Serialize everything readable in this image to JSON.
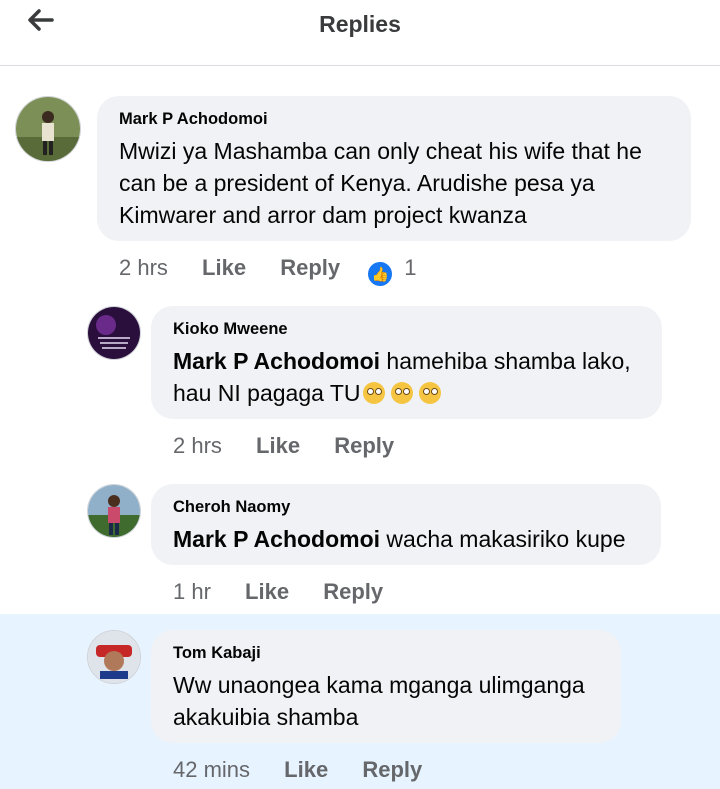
{
  "header": {
    "title": "Replies"
  },
  "comments": [
    {
      "name": "Mark P Achodomoi",
      "text": "Mwizi ya Mashamba can only cheat his wife that he can be a president of Kenya. Arudishe pesa ya Kimwarer and arror dam project kwanza",
      "time": "2 hrs",
      "like": "Like",
      "reply": "Reply",
      "reaction_count": "1"
    },
    {
      "name": "Kioko Mweene",
      "mention": "Mark P Achodomoi",
      "text": " hamehiba shamba lako, hau NI pagaga TU",
      "emoji": [
        "rolling-eyes",
        "rolling-eyes",
        "rolling-eyes"
      ],
      "time": "2 hrs",
      "like": "Like",
      "reply": "Reply"
    },
    {
      "name": "Cheroh Naomy",
      "mention": "Mark P Achodomoi",
      "text": " wacha makasiriko kupe",
      "time": "1 hr",
      "like": "Like",
      "reply": "Reply"
    },
    {
      "name": "Tom Kabaji",
      "text": "Ww unaongea kama mganga ulimganga akakuibia shamba",
      "time": "42 mins",
      "like": "Like",
      "reply": "Reply"
    }
  ],
  "colors": {
    "bubble": "#f0f2f5",
    "highlight": "#e7f3ff",
    "secondary_text": "#65676b",
    "reaction_blue": "#1877f2"
  }
}
